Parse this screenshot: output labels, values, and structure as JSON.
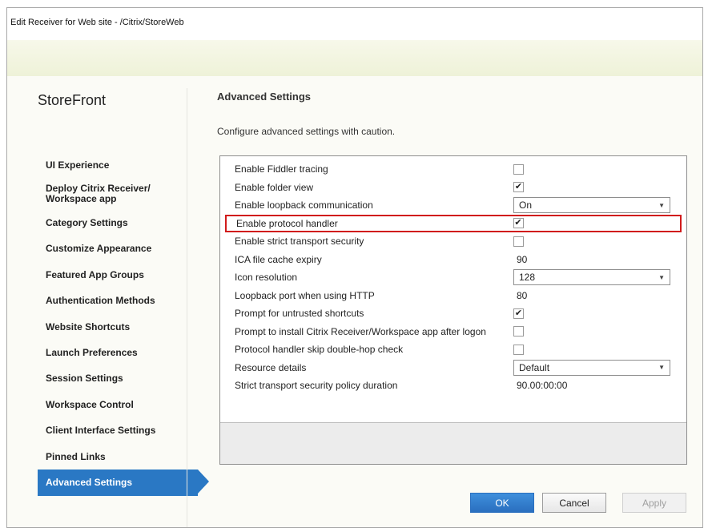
{
  "window": {
    "title": "Edit Receiver for Web site - /Citrix/StoreWeb"
  },
  "sidebar": {
    "product": "StoreFront",
    "items": [
      {
        "label": "UI Experience"
      },
      {
        "label": "Deploy Citrix Receiver/ Workspace app"
      },
      {
        "label": "Category Settings"
      },
      {
        "label": "Customize Appearance"
      },
      {
        "label": "Featured App Groups"
      },
      {
        "label": "Authentication Methods"
      },
      {
        "label": "Website Shortcuts"
      },
      {
        "label": "Launch Preferences"
      },
      {
        "label": "Session Settings"
      },
      {
        "label": "Workspace Control"
      },
      {
        "label": "Client Interface Settings"
      },
      {
        "label": "Pinned Links"
      },
      {
        "label": "Advanced Settings"
      }
    ],
    "active_item": "Advanced Settings"
  },
  "main": {
    "heading": "Advanced Settings",
    "description": "Configure advanced settings with caution.",
    "settings": [
      {
        "name": "Enable Fiddler tracing",
        "type": "checkbox",
        "checked": false,
        "mark": ""
      },
      {
        "name": "Enable folder view",
        "type": "checkbox",
        "checked": true,
        "mark": "✔"
      },
      {
        "name": "Enable loopback communication",
        "type": "select",
        "value": "On"
      },
      {
        "name": "Enable protocol handler",
        "type": "checkbox",
        "checked": true,
        "mark": "✔"
      },
      {
        "name": "Enable strict transport security",
        "type": "checkbox",
        "checked": false,
        "mark": ""
      },
      {
        "name": "ICA file cache expiry",
        "type": "text",
        "value": "90"
      },
      {
        "name": "Icon resolution",
        "type": "select",
        "value": "128"
      },
      {
        "name": "Loopback port when using HTTP",
        "type": "text",
        "value": "80"
      },
      {
        "name": "Prompt for untrusted shortcuts",
        "type": "checkbox",
        "checked": true,
        "mark": "✔"
      },
      {
        "name": "Prompt to install Citrix Receiver/Workspace app after logon",
        "type": "checkbox",
        "checked": false,
        "mark": ""
      },
      {
        "name": "Protocol handler skip double-hop check",
        "type": "checkbox",
        "checked": false,
        "mark": ""
      },
      {
        "name": "Resource details",
        "type": "select",
        "value": "Default"
      },
      {
        "name": "Strict transport security policy duration",
        "type": "text",
        "value": "90.00:00:00"
      }
    ],
    "highlighted_setting": "Enable protocol handler",
    "highlight_color": "#d11b1b"
  },
  "buttons": {
    "ok": "OK",
    "cancel": "Cancel",
    "apply": "Apply"
  },
  "colors": {
    "accent": "#2a78c4"
  }
}
